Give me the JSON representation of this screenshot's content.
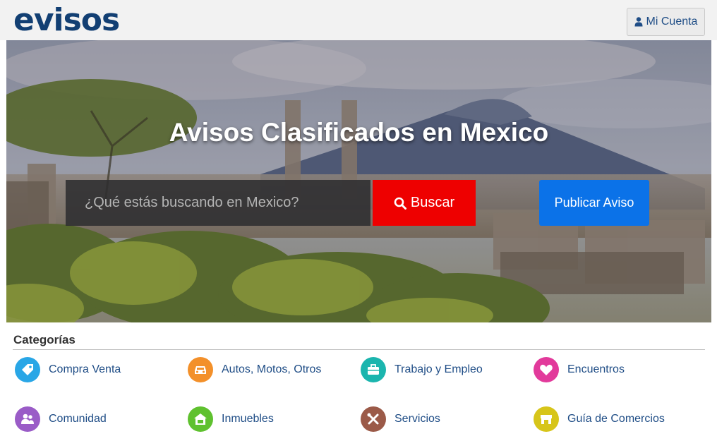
{
  "header": {
    "logo_text": "evisos",
    "account_label": "Mi Cuenta"
  },
  "hero": {
    "title": "Avisos Clasificados en Mexico",
    "search_placeholder": "¿Qué estás buscando en Mexico?",
    "search_button_label": "Buscar",
    "publish_button_label": "Publicar Aviso"
  },
  "colors": {
    "brand": "#123f73",
    "search_button": "#ee0000",
    "publish_button": "#0b72e8",
    "link": "#1f4d86"
  },
  "categories": {
    "heading": "Categorías",
    "items": [
      {
        "label": "Compra Venta",
        "icon": "tag-icon",
        "color": "#29a6e6"
      },
      {
        "label": "Autos, Motos, Otros",
        "icon": "car-icon",
        "color": "#f3902a"
      },
      {
        "label": "Trabajo y Empleo",
        "icon": "briefcase-icon",
        "color": "#1bb5ae"
      },
      {
        "label": "Encuentros",
        "icon": "heart-icon",
        "color": "#e23a9b"
      },
      {
        "label": "Comunidad",
        "icon": "people-icon",
        "color": "#9a5cc7"
      },
      {
        "label": "Inmuebles",
        "icon": "house-icon",
        "color": "#5fc12f"
      },
      {
        "label": "Servicios",
        "icon": "tools-icon",
        "color": "#9b5a48"
      },
      {
        "label": "Guía de Comercios",
        "icon": "store-icon",
        "color": "#d7c51a"
      }
    ]
  }
}
